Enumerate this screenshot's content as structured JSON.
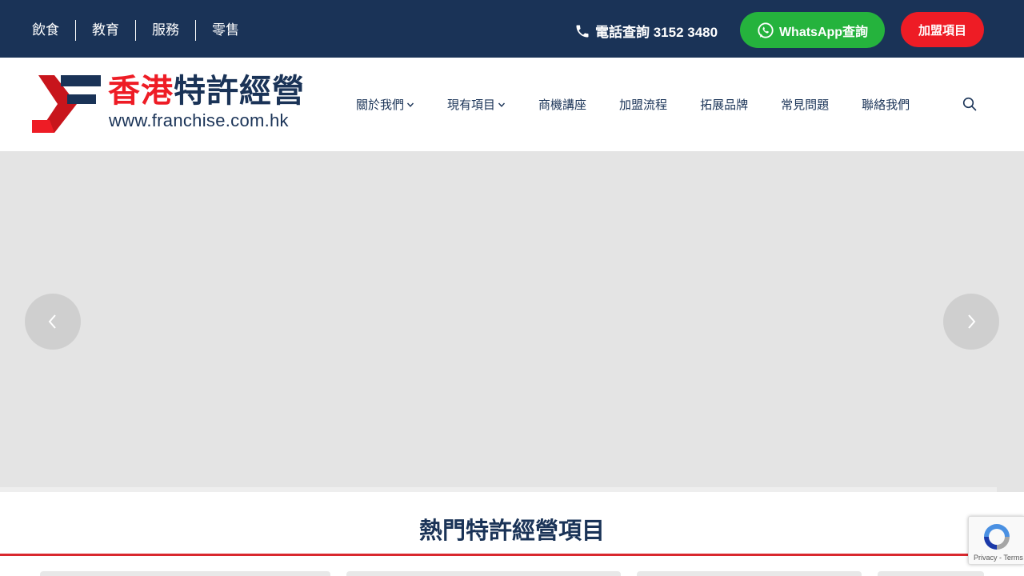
{
  "topbar": {
    "categories": [
      "飲食",
      "教育",
      "服務",
      "零售"
    ],
    "phone_text": "電話查詢 3152 3480",
    "whatsapp_label": "WhatsApp查詢",
    "join_label": "加盟項目"
  },
  "header": {
    "logo_title_red": "香港",
    "logo_title_navy": "特許經營",
    "logo_url": "www.franchise.com.hk",
    "nav": [
      "關於我們",
      "現有項目",
      "商機講座",
      "加盟流程",
      "拓展品牌",
      "常見問題",
      "聯絡我們"
    ]
  },
  "section": {
    "title": "熱門特許經營項目"
  },
  "recaptcha": {
    "privacy": "Privacy",
    "terms": "Terms"
  },
  "colors": {
    "navy": "#1a3357",
    "red": "#ee1c25",
    "green": "#25b33d",
    "slider_bg": "#e4e4e4"
  }
}
